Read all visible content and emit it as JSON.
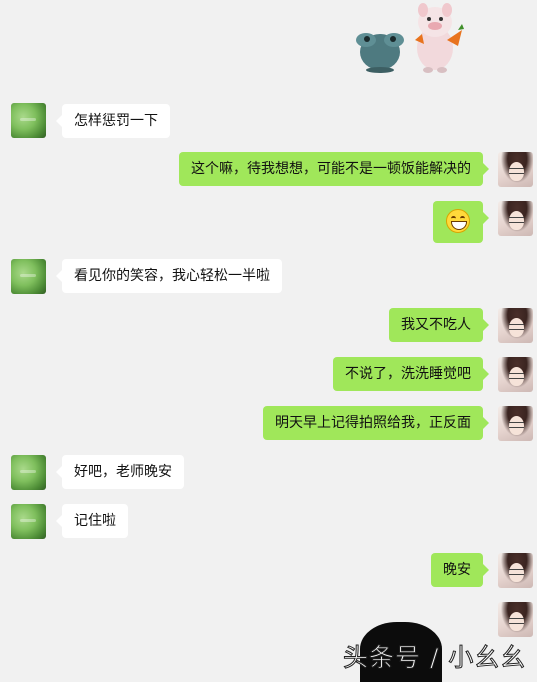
{
  "sticker": {
    "description_icon": "frog-and-pig-sticker"
  },
  "messages": [
    {
      "side": "in",
      "text": "怎样惩罚一下"
    },
    {
      "side": "out",
      "text": "这个嘛，待我想想，可能不是一顿饭能解决的"
    },
    {
      "side": "out",
      "emoji": "grinning-face-icon"
    },
    {
      "side": "in",
      "text": "看见你的笑容，我心轻松一半啦"
    },
    {
      "side": "out",
      "text": "我又不吃人"
    },
    {
      "side": "out",
      "text": "不说了，洗洗睡觉吧"
    },
    {
      "side": "out",
      "text": "明天早上记得拍照给我，正反面"
    },
    {
      "side": "in",
      "text": "好吧，老师晚安"
    },
    {
      "side": "in",
      "text": "记住啦"
    },
    {
      "side": "out",
      "text": "晚安"
    }
  ],
  "watermark": {
    "text": "头条号 / 小幺幺"
  },
  "colors": {
    "background": "#f1f1f1",
    "outgoing_bubble": "#a0e75a",
    "incoming_bubble": "#ffffff"
  }
}
